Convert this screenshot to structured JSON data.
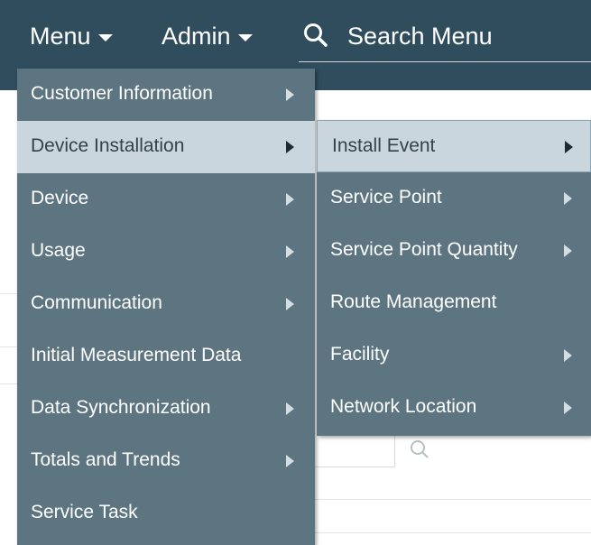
{
  "nav": {
    "menu_label": "Menu",
    "admin_label": "Admin",
    "search_placeholder": "Search Menu"
  },
  "menu": {
    "items": [
      {
        "label": "Customer Information",
        "has_submenu": true,
        "active": false
      },
      {
        "label": "Device Installation",
        "has_submenu": true,
        "active": true
      },
      {
        "label": "Device",
        "has_submenu": true,
        "active": false
      },
      {
        "label": "Usage",
        "has_submenu": true,
        "active": false
      },
      {
        "label": "Communication",
        "has_submenu": true,
        "active": false
      },
      {
        "label": "Initial Measurement Data",
        "has_submenu": false,
        "active": false
      },
      {
        "label": "Data Synchronization",
        "has_submenu": true,
        "active": false
      },
      {
        "label": "Totals and Trends",
        "has_submenu": true,
        "active": false
      },
      {
        "label": "Service Task",
        "has_submenu": false,
        "active": false
      }
    ]
  },
  "submenu": {
    "items": [
      {
        "label": "Install Event",
        "has_submenu": true,
        "active": true
      },
      {
        "label": "Service Point",
        "has_submenu": true,
        "active": false
      },
      {
        "label": "Service Point Quantity",
        "has_submenu": true,
        "active": false
      },
      {
        "label": "Route Management",
        "has_submenu": false,
        "active": false
      },
      {
        "label": "Facility",
        "has_submenu": true,
        "active": false
      },
      {
        "label": "Network Location",
        "has_submenu": true,
        "active": false
      }
    ]
  },
  "colors": {
    "topbar": "#2f4d5c",
    "menu_bg": "#5d7581",
    "active_bg": "#c9d6dd"
  }
}
